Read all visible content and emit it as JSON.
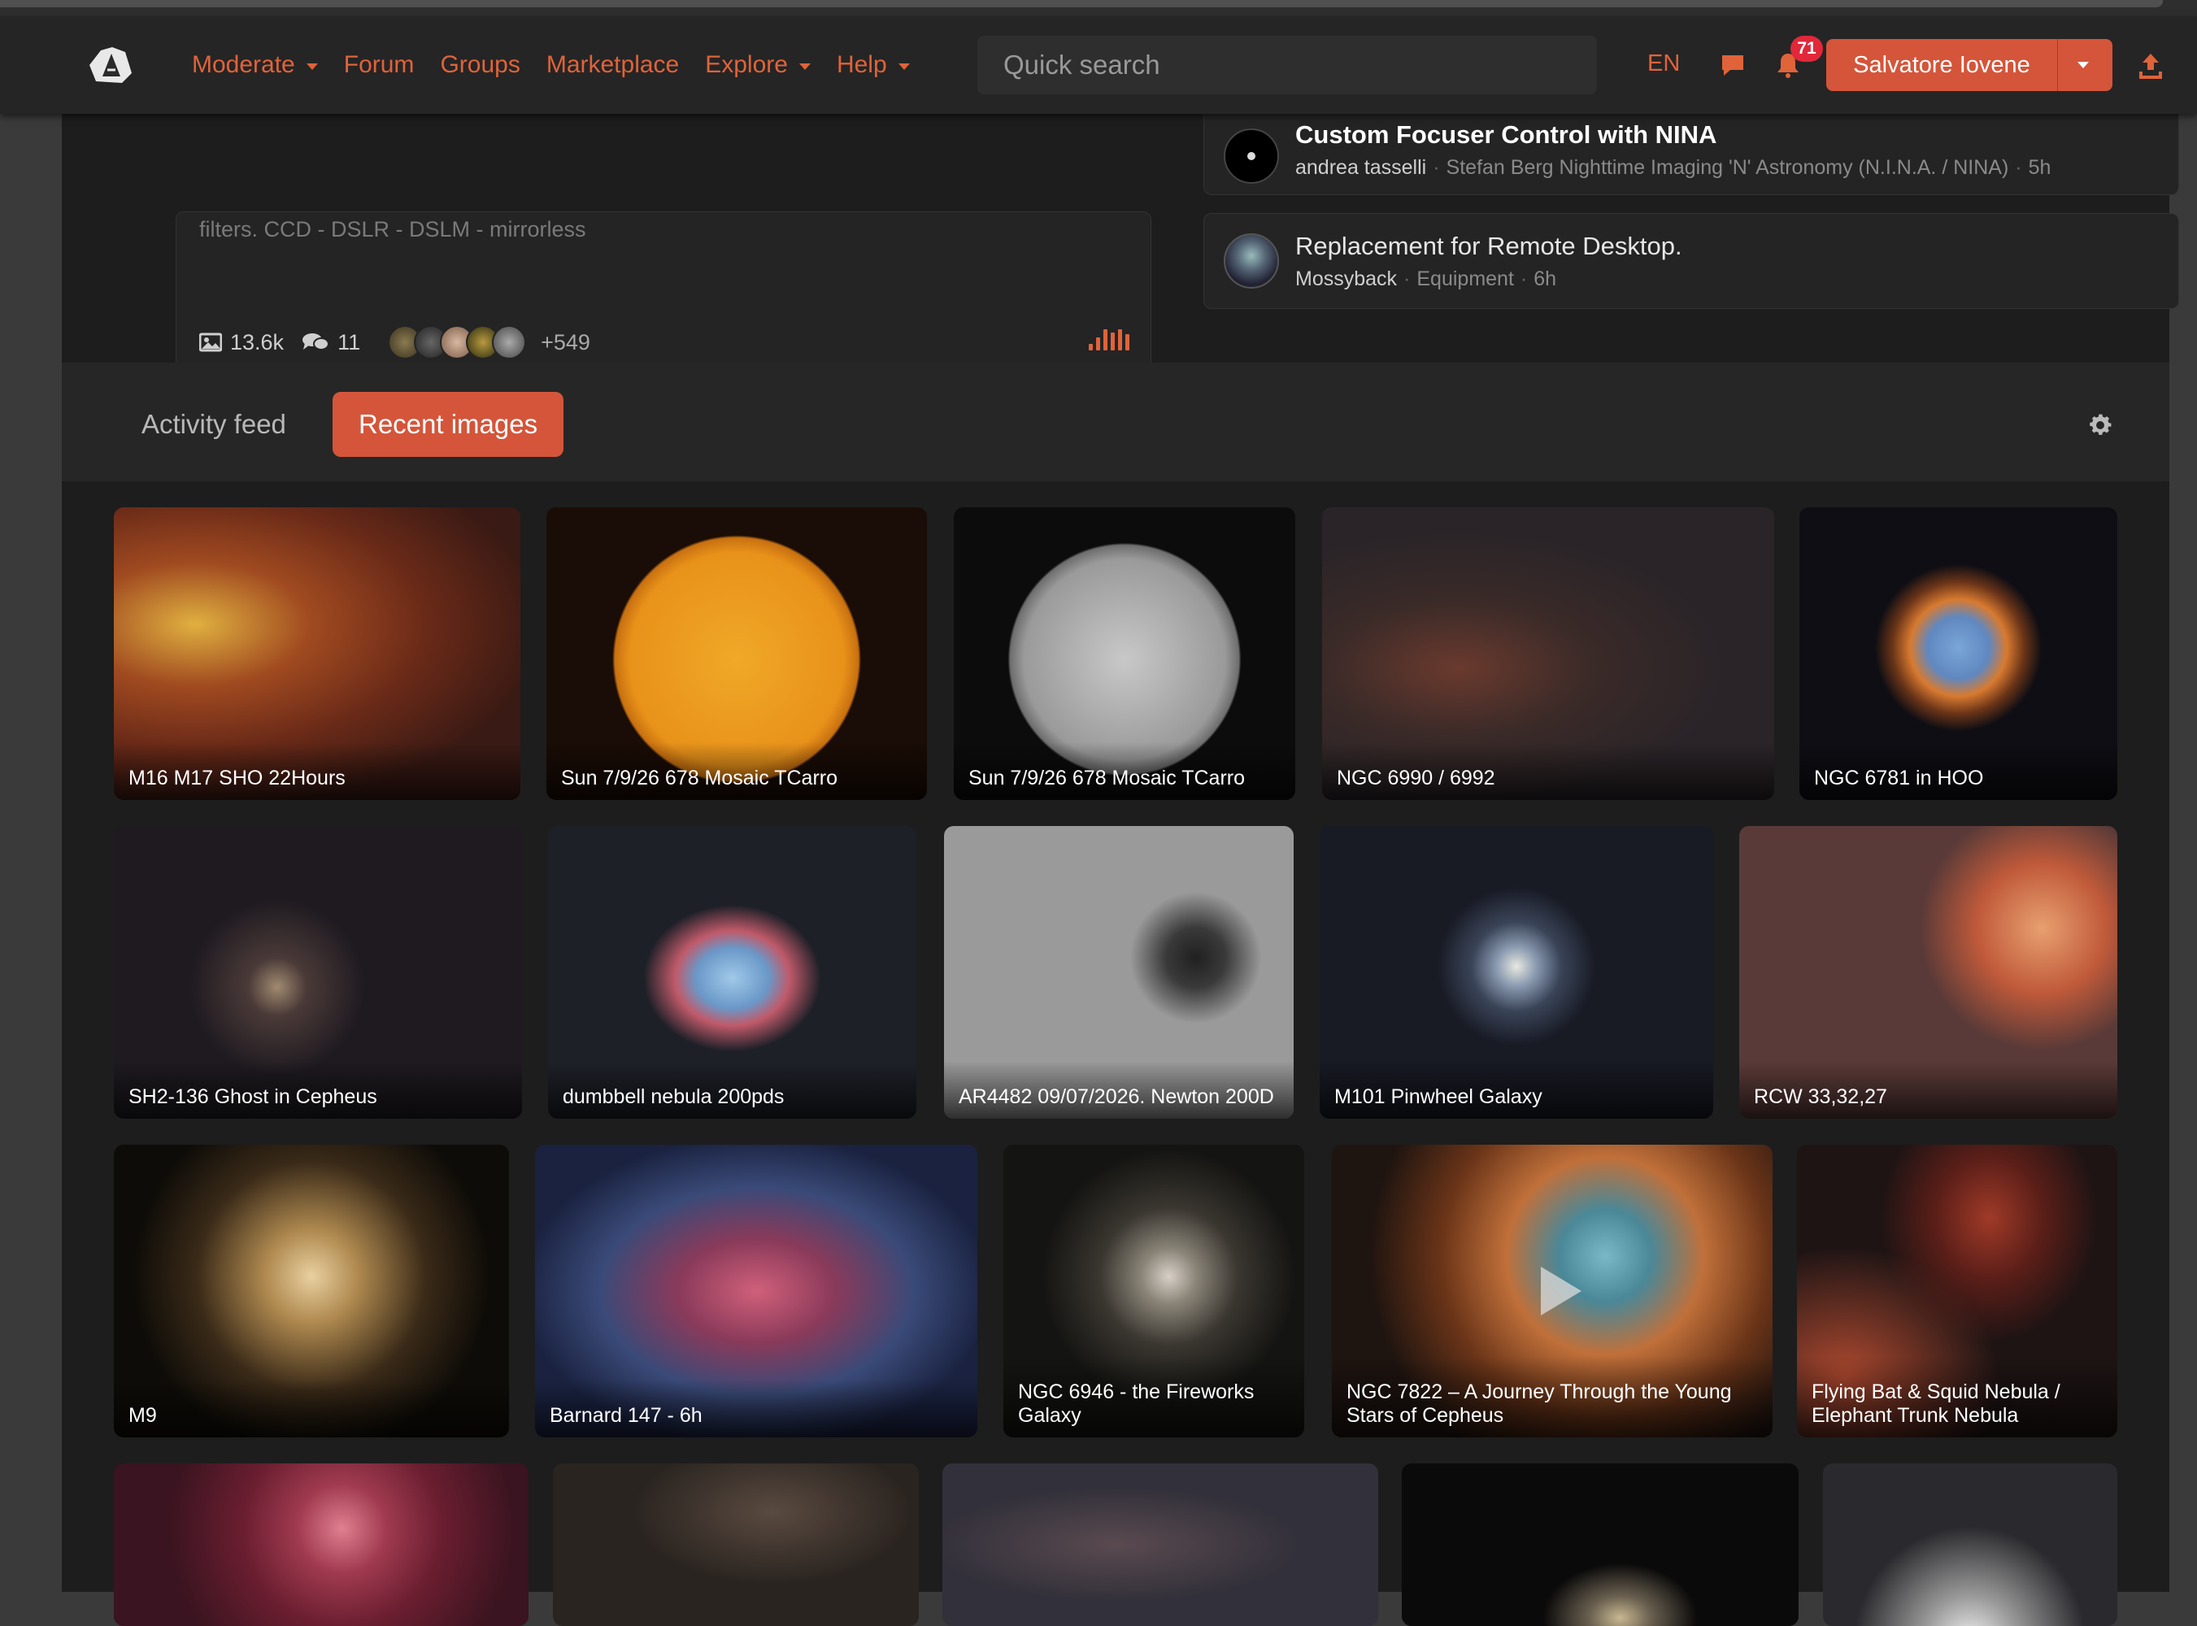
{
  "nav": {
    "logo_letter": "A",
    "links": [
      {
        "label": "Moderate",
        "dropdown": true
      },
      {
        "label": "Forum",
        "dropdown": false
      },
      {
        "label": "Groups",
        "dropdown": false
      },
      {
        "label": "Marketplace",
        "dropdown": false
      },
      {
        "label": "Explore",
        "dropdown": true
      },
      {
        "label": "Help",
        "dropdown": true
      }
    ],
    "search_placeholder": "Quick search",
    "language": "EN",
    "notification_count": "71",
    "user_name": "Salvatore Iovene",
    "accent_color": "#e0633a"
  },
  "group_card": {
    "description": "filters. CCD - DSLR - DSLM - mirrorless",
    "images_count": "13.6k",
    "comments_count": "11",
    "members_more": "+549"
  },
  "topics": [
    {
      "title": "Custom Focuser Control with NINA",
      "author": "andrea tasselli",
      "forum": "Stefan Berg Nighttime Imaging 'N' Astronomy (N.I.N.A. / NINA)",
      "age": "5h"
    },
    {
      "title": "Replacement for Remote Desktop.",
      "author": "Mossyback",
      "forum": "Equipment",
      "age": "6h"
    }
  ],
  "tabs": {
    "activity_feed": "Activity feed",
    "recent_images": "Recent images",
    "active": "recent_images"
  },
  "images": [
    {
      "title": "M16 M17 SHO 22Hours"
    },
    {
      "title": "Sun 7/9/26 678 Mosaic TCarro"
    },
    {
      "title": "Sun 7/9/26 678 Mosaic TCarro"
    },
    {
      "title": "NGC 6990 / 6992"
    },
    {
      "title": "NGC 6781 in HOO"
    },
    {
      "title": "SH2-136 Ghost in Cepheus"
    },
    {
      "title": "dumbbell nebula 200pds"
    },
    {
      "title": "AR4482 09/07/2026. Newton 200D"
    },
    {
      "title": "M101 Pinwheel Galaxy"
    },
    {
      "title": "RCW 33,32,27"
    },
    {
      "title": "M9"
    },
    {
      "title": "Barnard 147 - 6h"
    },
    {
      "title": "NGC 6946 - the Fireworks Galaxy"
    },
    {
      "title": "NGC 7822 – A Journey Through the Young Stars of Cepheus",
      "video": true
    },
    {
      "title": "Flying Bat & Squid Nebula / Elephant Trunk Nebula"
    }
  ]
}
